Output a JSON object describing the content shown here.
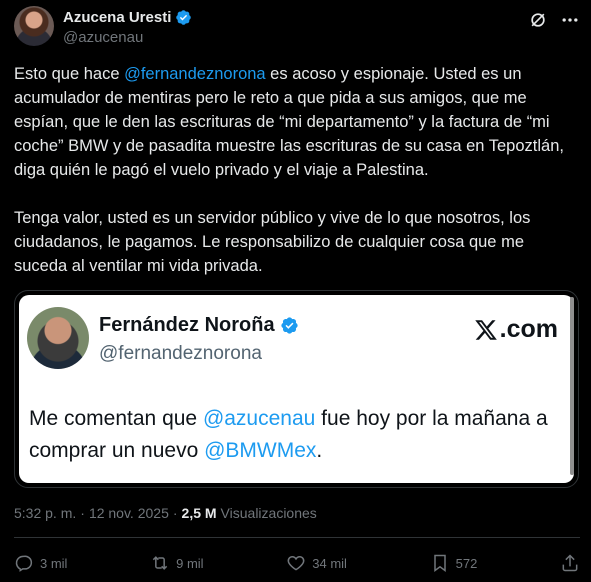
{
  "author": {
    "name": "Azucena Uresti",
    "handle": "@azucenau"
  },
  "tweet": {
    "part1": "Esto que hace ",
    "mention": "@fernandeznorona",
    "part2": " es acoso y espionaje. Usted es un acumulador de mentiras pero le reto a que pida a sus amigos, que me espían, que le den las escrituras de “mi departamento”  y la factura de “mi coche” BMW y de pasadita muestre las escrituras de su casa en Tepoztlán, diga quién le pagó el vuelo privado y el viaje a Palestina.\n\nTenga valor, usted es un servidor público y vive de lo que nosotros, los ciudadanos, le pagamos. Le responsabilizo de cualquier cosa que me suceda al ventilar mi vida privada."
  },
  "quoted": {
    "name": "Fernández Noroña",
    "handle": "@fernandeznorona",
    "logo_text": ".com",
    "text1": "Me comentan que ",
    "mention1": "@azucenau",
    "text2": " fue hoy por la mañana a comprar un nuevo ",
    "mention2": "@BMWMex",
    "text3": "."
  },
  "meta": {
    "time": "5:32 p. m.",
    "sep1": "·",
    "date": "12 nov. 2025",
    "sep2": "·",
    "views": "2,5 M",
    "views_label": "Visualizaciones"
  },
  "actions": {
    "replies": "3 mil",
    "reposts": "9 mil",
    "likes": "34 mil",
    "bookmarks": "572"
  },
  "colors": {
    "accent": "#1d9bf0",
    "muted": "#71767b",
    "background": "#000000"
  }
}
